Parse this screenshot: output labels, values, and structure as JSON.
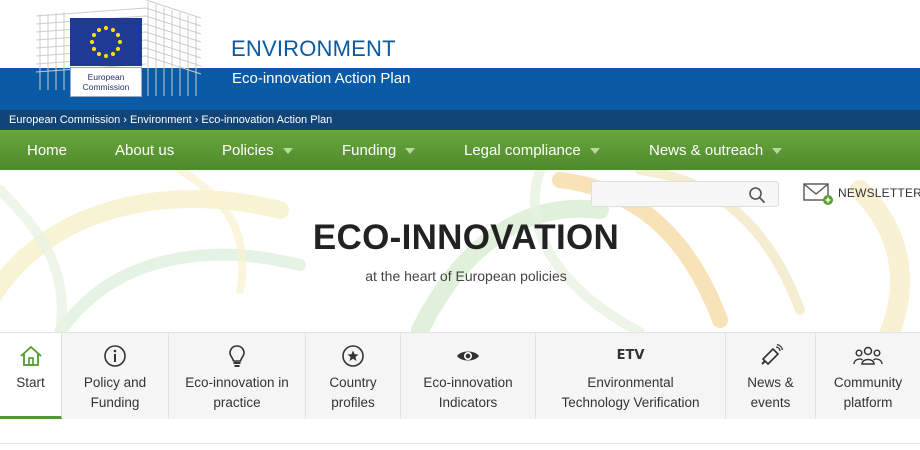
{
  "header": {
    "logo_text": "European Commission",
    "site_title": "ENVIRONMENT",
    "site_subtitle": "Eco-innovation Action Plan"
  },
  "breadcrumb": [
    "European Commission",
    "Environment",
    "Eco-innovation Action Plan"
  ],
  "nav": [
    {
      "label": "Home",
      "dropdown": false
    },
    {
      "label": "About us",
      "dropdown": false
    },
    {
      "label": "Policies",
      "dropdown": true
    },
    {
      "label": "Funding",
      "dropdown": true
    },
    {
      "label": "Legal compliance",
      "dropdown": true
    },
    {
      "label": "News & outreach",
      "dropdown": true
    }
  ],
  "search": {
    "value": ""
  },
  "newsletter": {
    "label": "NEWSLETTER"
  },
  "hero": {
    "title": "ECO-INNOVATION",
    "subtitle": "at the heart of European policies"
  },
  "tabs": [
    {
      "line1": "Start",
      "line2": "",
      "icon": "home-icon",
      "active": true
    },
    {
      "line1": "Policy and",
      "line2": "Funding",
      "icon": "info-icon",
      "active": false
    },
    {
      "line1": "Eco-innovation in",
      "line2": "practice",
      "icon": "lightbulb-icon",
      "active": false
    },
    {
      "line1": "Country",
      "line2": "profiles",
      "icon": "star-circle-icon",
      "active": false
    },
    {
      "line1": "Eco-innovation",
      "line2": "Indicators",
      "icon": "eye-icon",
      "active": false
    },
    {
      "line1": "Environmental",
      "line2": "Technology Verification",
      "icon_text": "ETV",
      "icon": "etv-icon",
      "active": false
    },
    {
      "line1": "News &",
      "line2": "events",
      "icon": "megaphone-icon",
      "active": false
    },
    {
      "line1": "Community",
      "line2": "platform",
      "icon": "community-icon",
      "active": false
    }
  ],
  "colors": {
    "header_blue": "#0a5aa6",
    "breadcrumb_bg": "#114477",
    "nav_green": "#5b982f",
    "accent_green": "#4f9a2f"
  }
}
